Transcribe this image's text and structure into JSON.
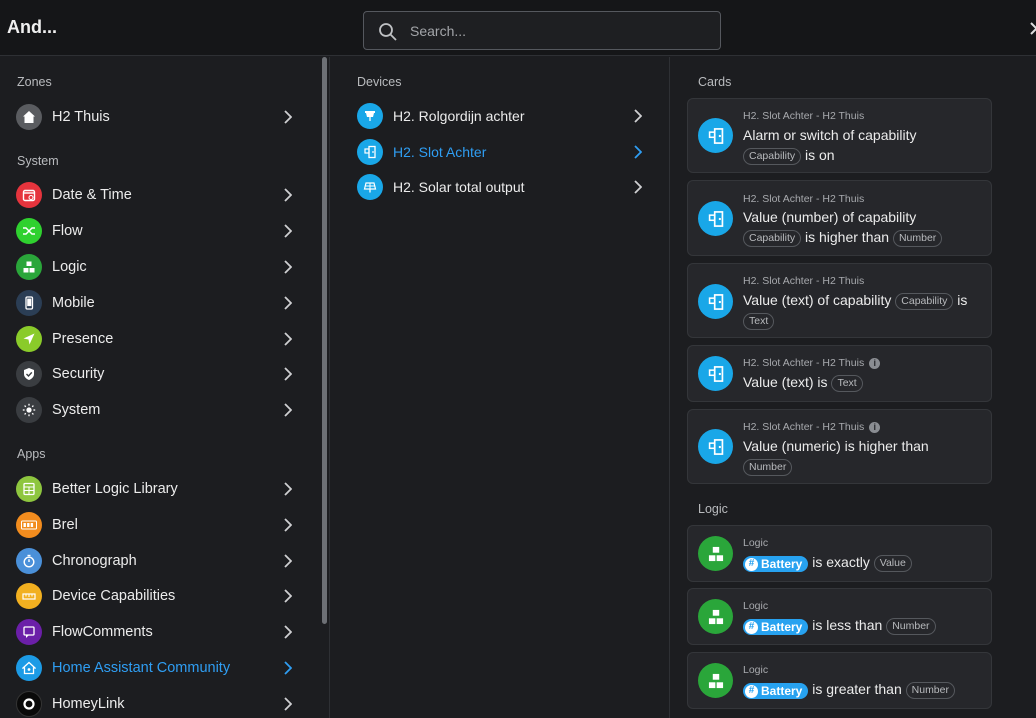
{
  "header": {
    "title": "And...",
    "search_placeholder": "Search..."
  },
  "left": {
    "zones_heading": "Zones",
    "zones": [
      {
        "label": "H2 Thuis",
        "icon": "home-icon",
        "color": "#5a5c60"
      }
    ],
    "system_heading": "System",
    "system": [
      {
        "label": "Date & Time",
        "icon": "calendar-clock-icon",
        "color": "#e5343d"
      },
      {
        "label": "Flow",
        "icon": "shuffle-icon",
        "color": "#2fd12f"
      },
      {
        "label": "Logic",
        "icon": "logic-blocks-icon",
        "color": "#2aa63a"
      },
      {
        "label": "Mobile",
        "icon": "phone-icon",
        "color": "#2b3e55"
      },
      {
        "label": "Presence",
        "icon": "location-arrow-icon",
        "color": "#8acb2a"
      },
      {
        "label": "Security",
        "icon": "shield-icon",
        "color": "#3a3d41"
      },
      {
        "label": "System",
        "icon": "gear-sun-icon",
        "color": "#3a3d41"
      }
    ],
    "apps_heading": "Apps",
    "apps": [
      {
        "label": "Better Logic Library",
        "icon": "calculator-icon",
        "color": "#8ec63f"
      },
      {
        "label": "Brel",
        "icon": "brel-logo-icon",
        "color": "#f28c1e"
      },
      {
        "label": "Chronograph",
        "icon": "stopwatch-icon",
        "color": "#4a90d9"
      },
      {
        "label": "Device Capabilities",
        "icon": "ruler-icon",
        "color": "#f2b020"
      },
      {
        "label": "FlowComments",
        "icon": "comment-icon",
        "color": "#6b1fa8"
      },
      {
        "label": "Home Assistant Community",
        "icon": "home-assistant-icon",
        "color": "#1c9be6"
      },
      {
        "label": "HomeyLink",
        "icon": "homey-ring-icon",
        "color": "#0a0a0a"
      }
    ]
  },
  "devices": {
    "heading": "Devices",
    "items": [
      {
        "label": "H2. Rolgordijn achter",
        "icon": "blind-icon"
      },
      {
        "label": "H2. Slot Achter",
        "icon": "door-lock-icon"
      },
      {
        "label": "H2. Solar total output",
        "icon": "solar-panel-icon"
      }
    ]
  },
  "cards": {
    "heading": "Cards",
    "items": [
      {
        "sub": "H2. Slot Achter - H2 Thuis",
        "t1": "Alarm or switch of capability",
        "tag1": "Capability",
        "t2": "is on"
      },
      {
        "sub": "H2. Slot Achter - H2 Thuis",
        "t1": "Value (number) of capability",
        "tag1": "Capability",
        "t2": "is higher than",
        "tag2": "Number"
      },
      {
        "sub": "H2. Slot Achter - H2 Thuis",
        "t1": "Value (text) of capability",
        "tag1": "Capability",
        "t2": "is",
        "tag2": "Text"
      },
      {
        "sub": "H2. Slot Achter - H2 Thuis",
        "t1": "Value (text) is",
        "tag1": "Text"
      },
      {
        "sub": "H2. Slot Achter - H2 Thuis",
        "t1": "Value (numeric) is higher than",
        "tag1": "Number"
      }
    ],
    "logic_heading": "Logic",
    "logic": [
      {
        "sub": "Logic",
        "pill": "Battery",
        "t": "is exactly",
        "tag": "Value"
      },
      {
        "sub": "Logic",
        "pill": "Battery",
        "t": "is less than",
        "tag": "Number"
      },
      {
        "sub": "Logic",
        "pill": "Battery",
        "t": "is greater than",
        "tag": "Number"
      }
    ]
  }
}
